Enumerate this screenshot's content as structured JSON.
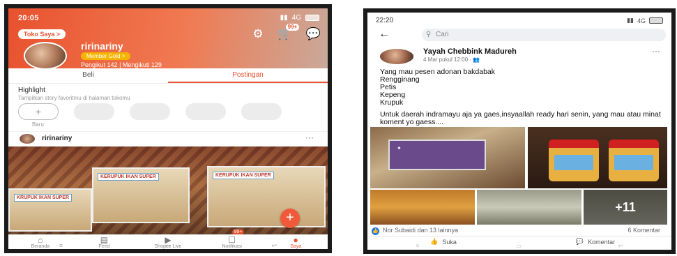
{
  "shopee": {
    "status": {
      "time": "20:05",
      "indicators": "4G"
    },
    "toko_saya": "Toko Saya >",
    "cart_badge": "99+",
    "shop_name": "ririnariny",
    "member_badge": "Member Gold >",
    "followers": "Pengikut 142",
    "following": "Mengikuti 129",
    "tabs": [
      {
        "label": "Beli",
        "active": false
      },
      {
        "label": "Postingan",
        "active": true
      }
    ],
    "highlight": {
      "title": "Highlight",
      "subtitle": "Tampilkan story favoritmu di halaman tokomu",
      "new_label": "Baru"
    },
    "post": {
      "user": "ririnariny",
      "more": "···",
      "pack_labels": [
        "KERUPUK IKAN SUPER",
        "KERUPUK IKAN SUPER",
        "KRUPUK IKAN SUPER"
      ]
    },
    "nav": [
      {
        "label": "Beranda",
        "icon": "home-icon",
        "active": false
      },
      {
        "label": "Feed",
        "icon": "feed-icon",
        "active": false
      },
      {
        "label": "Shopee Live",
        "icon": "live-icon",
        "active": false
      },
      {
        "label": "Notifikasi",
        "icon": "bell-icon",
        "active": false,
        "badge": "99+"
      },
      {
        "label": "Saya",
        "icon": "person-icon",
        "active": true
      }
    ],
    "colors": {
      "accent": "#e8522e"
    }
  },
  "facebook": {
    "status": {
      "time": "22:20",
      "indicators": "4G"
    },
    "search_placeholder": "Cari",
    "post": {
      "author": "Yayah Chebbink Madureh",
      "date": "4 Mar pukul 12:00 · ",
      "more": "···",
      "lines": [
        "Yang mau pesen adonan bakdabak",
        "Rengginang",
        "Petis",
        "Kepeng",
        "Krupuk"
      ],
      "paragraph2": "Untuk daerah indramayu aja ya gaes,insyaallah ready hari senin, yang mau atau minat koment yo gaess....",
      "more_photos": "+11",
      "reactions": "Nor Subaidi dan 13 lainnya",
      "comments": "6 Komentar",
      "like_label": "Suka",
      "comment_label": "Komentar"
    },
    "colors": {
      "accent": "#1877f2"
    }
  }
}
